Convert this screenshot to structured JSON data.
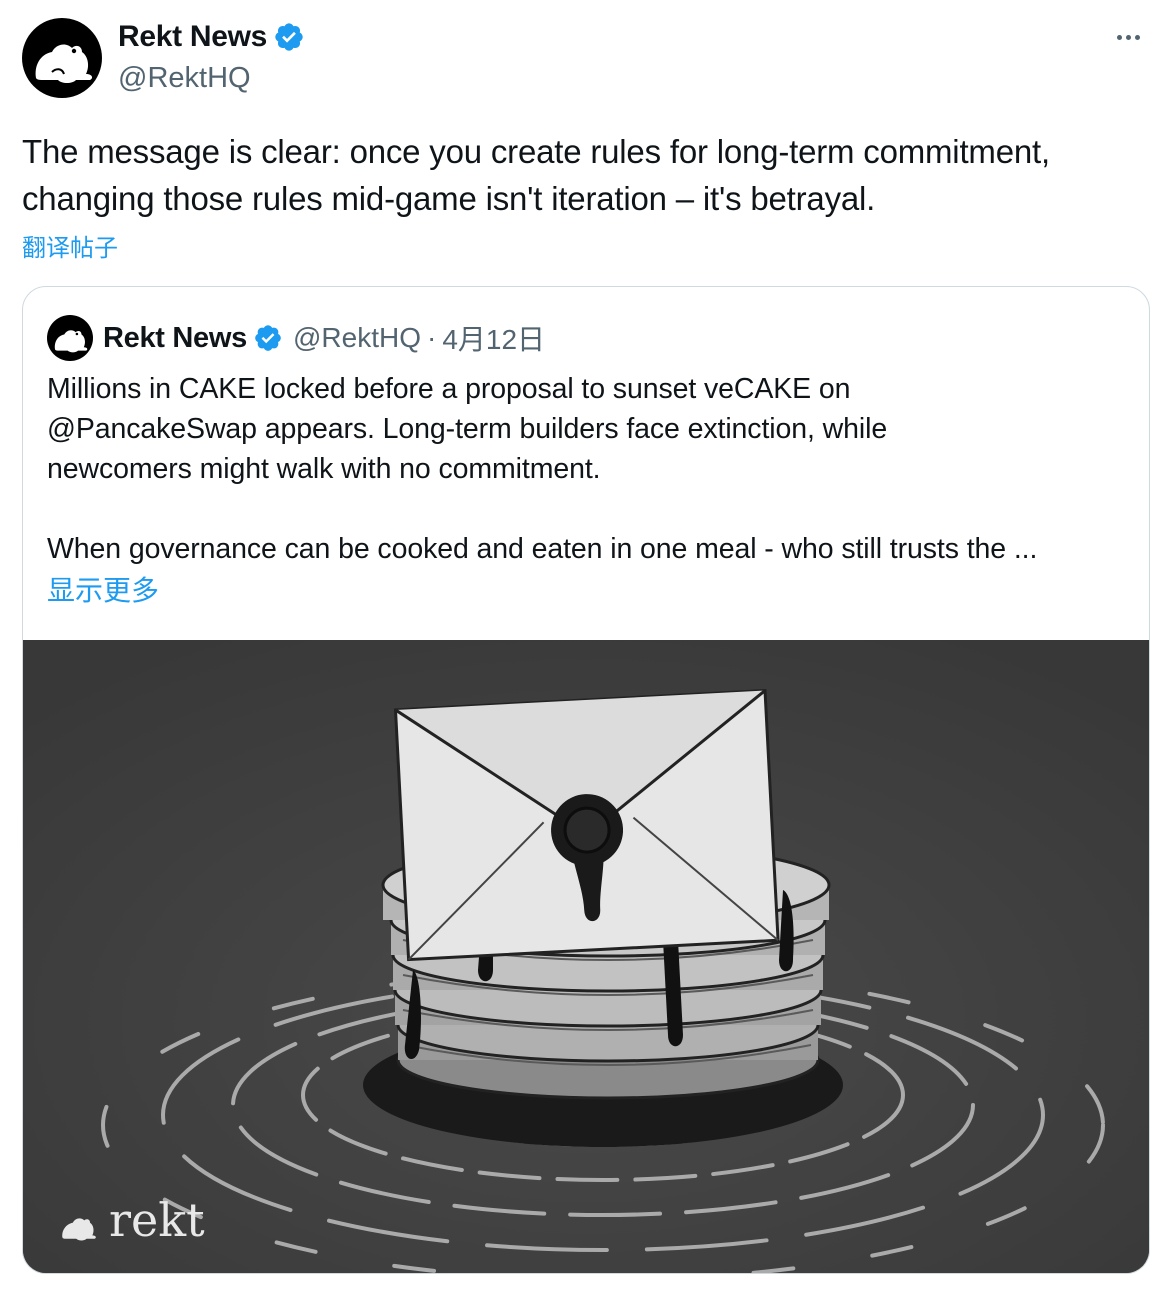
{
  "author": {
    "name": "Rekt News",
    "handle": "@RektHQ",
    "avatar_icon": "frog-icon",
    "verified_icon": "verified-badge-icon"
  },
  "tweet": {
    "text": "The message is clear: once you create rules for long-term commitment, changing those rules mid-game isn't iteration – it's betrayal.",
    "translate_label": "翻译帖子",
    "more_icon": "more-options-icon"
  },
  "quote": {
    "name": "Rekt News",
    "handle": "@RektHQ",
    "separator": "·",
    "date": "4月12日",
    "text": "Millions in CAKE  locked before a proposal to sunset veCAKE on\n@PancakeSwap appears. Long-term builders face extinction, while\nnewcomers might walk  with no commitment.\n\nWhen governance can be cooked and eaten in one meal - who still trusts the ...",
    "show_more_label": "显示更多",
    "media": {
      "watermark_text": "rekt",
      "watermark_icon": "frog-icon"
    }
  },
  "colors": {
    "link": "#1d9bf0",
    "secondary_text": "#536471",
    "border": "#cfd9de",
    "verified": "#1d9bf0"
  }
}
